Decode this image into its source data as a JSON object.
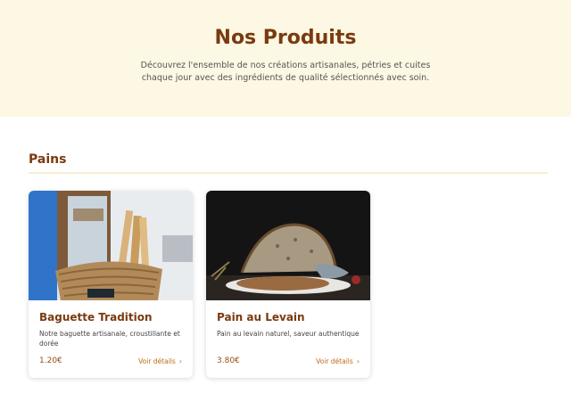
{
  "hero": {
    "title": "Nos Produits",
    "subtitle": "Découvrez l'ensemble de nos créations artisanales, pétries et cuites chaque jour avec des ingrédients de qualité sélectionnés avec soin."
  },
  "section": {
    "title": "Pains"
  },
  "products": [
    {
      "name": "Baguette Tradition",
      "description": "Notre baguette artisanale, croustillante et dorée",
      "price": "1.20€",
      "details_label": "Voir détails",
      "image": "baguette-basket-photo"
    },
    {
      "name": "Pain au Levain",
      "description": "Pain au levain naturel, saveur authentique",
      "price": "3.80€",
      "details_label": "Voir détails",
      "image": "sourdough-loaf-photo"
    }
  ],
  "colors": {
    "hero_bg": "#fcf8e3",
    "heading": "#7a3a10",
    "accent": "#c06a16"
  }
}
